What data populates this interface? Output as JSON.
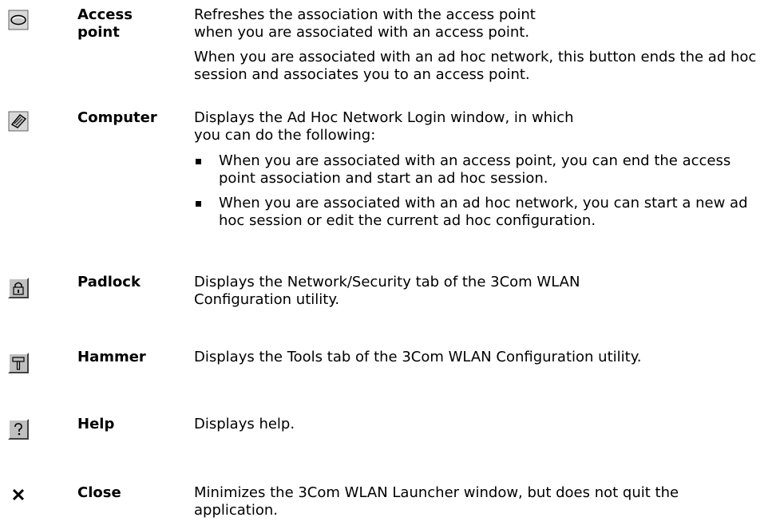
{
  "rows": [
    {
      "term": "Access\npoint",
      "icon": "access-point-icon",
      "paragraphs": [
        "Refreshes the association with the access point when you are associated with an access point.",
        "When you are associated with an ad hoc network, this button ends the ad hoc session and associates you to an access point."
      ]
    },
    {
      "term": "Computer",
      "icon": "computer-icon",
      "paragraphs": [
        "Displays the Ad Hoc Network Login window, in which you can do the following:"
      ],
      "bullets": [
        "When you are associated with an access point, you can end the access point association and start an ad hoc session.",
        "When you are associated with an ad hoc network, you can start a new ad hoc session or edit the current ad hoc configuration."
      ]
    },
    {
      "term": "Padlock",
      "icon": "padlock-icon",
      "paragraphs": [
        "Displays the Network/Security tab of the 3Com WLAN Configuration utility."
      ]
    },
    {
      "term": "Hammer",
      "icon": "hammer-icon",
      "paragraphs": [
        "Displays the Tools tab of the 3Com WLAN Configuration utility."
      ]
    },
    {
      "term": "Help",
      "icon": "help-icon",
      "paragraphs": [
        "Displays help."
      ]
    },
    {
      "term": "Close",
      "icon": "close-icon",
      "paragraphs": [
        "Minimizes the 3Com WLAN Launcher window, but does not quit the application."
      ]
    }
  ]
}
